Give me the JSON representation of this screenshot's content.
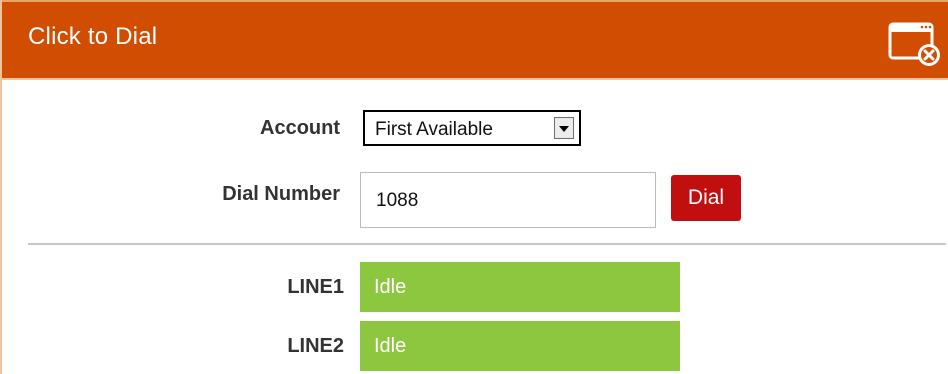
{
  "window": {
    "title": "Click to Dial",
    "close_icon": "window-close-icon",
    "accent_color": "#d04d02"
  },
  "form": {
    "account_label": "Account",
    "account_value": "First Available",
    "dial_label": "Dial Number",
    "dial_value": "1088",
    "dial_button": "Dial",
    "dial_button_color": "#c10f0f"
  },
  "lines": [
    {
      "label": "LINE1",
      "status": "Idle"
    },
    {
      "label": "LINE2",
      "status": "Idle"
    }
  ],
  "status_color": "#8dc63f"
}
